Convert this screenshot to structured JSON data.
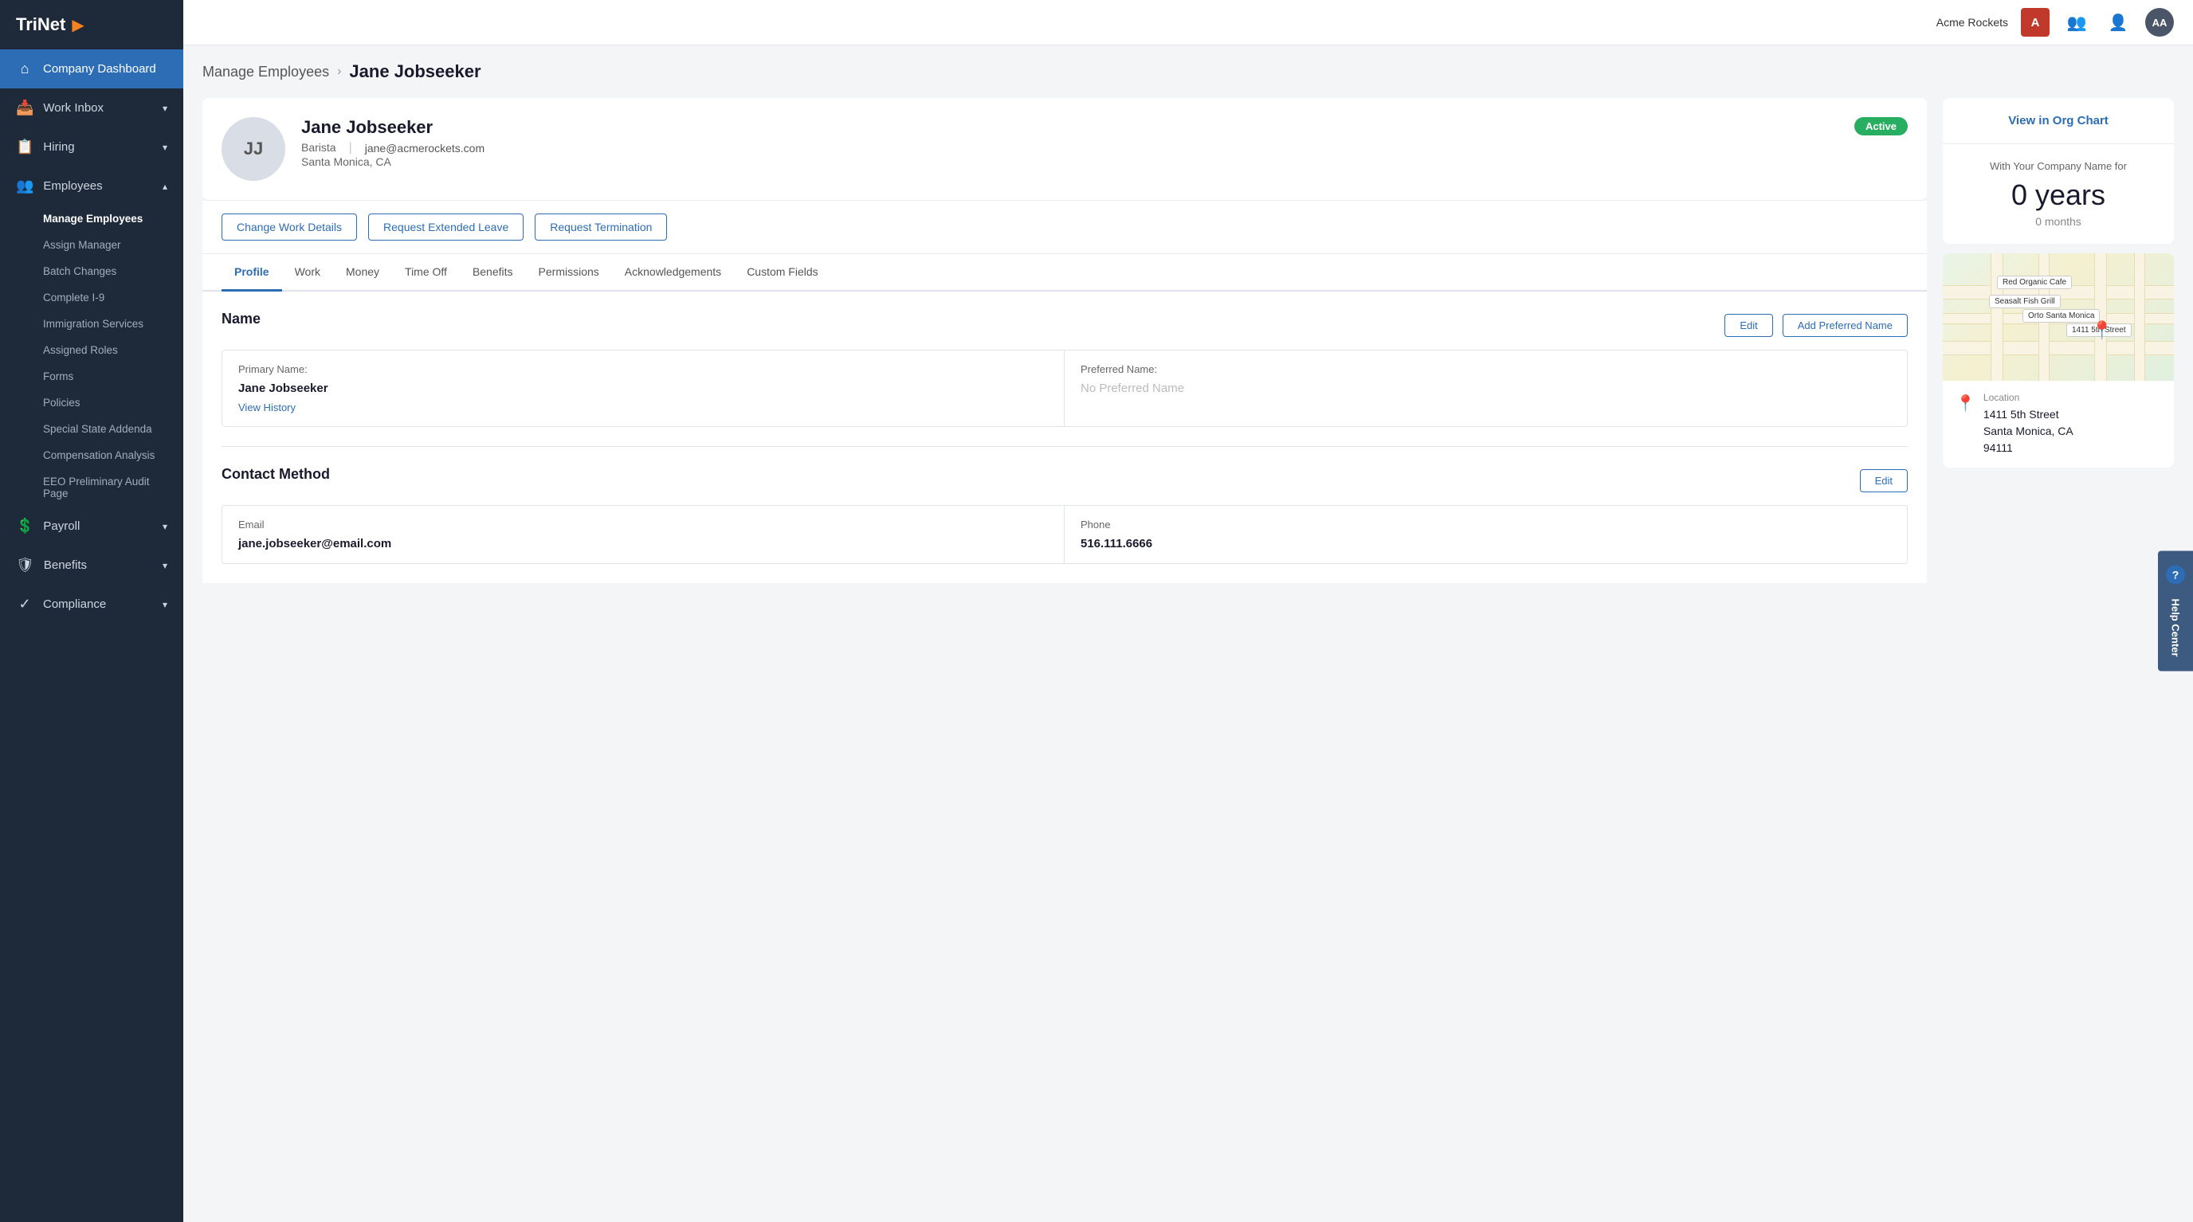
{
  "brand": {
    "name": "TriNet",
    "arrow": "▶"
  },
  "topbar": {
    "company_name": "Acme Rockets",
    "company_badge": "A",
    "user_initials": "AA"
  },
  "sidebar": {
    "items": [
      {
        "id": "company-dashboard",
        "label": "Company Dashboard",
        "icon": "⌂",
        "active": true,
        "hasChevron": false
      },
      {
        "id": "work-inbox",
        "label": "Work Inbox",
        "icon": "📥",
        "active": false,
        "hasChevron": true
      },
      {
        "id": "hiring",
        "label": "Hiring",
        "icon": "📋",
        "active": false,
        "hasChevron": true
      },
      {
        "id": "employees",
        "label": "Employees",
        "icon": "👥",
        "active": false,
        "hasChevron": true,
        "expanded": true
      },
      {
        "id": "payroll",
        "label": "Payroll",
        "icon": "💲",
        "active": false,
        "hasChevron": true
      },
      {
        "id": "benefits",
        "label": "Benefits",
        "icon": "🛡",
        "active": false,
        "hasChevron": true
      },
      {
        "id": "compliance",
        "label": "Compliance",
        "icon": "✓",
        "active": false,
        "hasChevron": true
      }
    ],
    "sub_items": [
      {
        "id": "manage-employees",
        "label": "Manage Employees",
        "active": true
      },
      {
        "id": "assign-manager",
        "label": "Assign Manager",
        "active": false
      },
      {
        "id": "batch-changes",
        "label": "Batch Changes",
        "active": false
      },
      {
        "id": "complete-i9",
        "label": "Complete I-9",
        "active": false
      },
      {
        "id": "immigration-services",
        "label": "Immigration Services",
        "active": false
      },
      {
        "id": "assigned-roles",
        "label": "Assigned Roles",
        "active": false
      },
      {
        "id": "forms",
        "label": "Forms",
        "active": false
      },
      {
        "id": "policies",
        "label": "Policies",
        "active": false
      },
      {
        "id": "special-state-addenda",
        "label": "Special State Addenda",
        "active": false
      },
      {
        "id": "compensation-analysis",
        "label": "Compensation Analysis",
        "active": false
      },
      {
        "id": "eeo-audit",
        "label": "EEO Preliminary Audit Page",
        "active": false
      }
    ]
  },
  "breadcrumb": {
    "parent": "Manage Employees",
    "current": "Jane Jobseeker"
  },
  "employee": {
    "initials": "JJ",
    "name": "Jane Jobseeker",
    "title": "Barista",
    "location": "Santa Monica, CA",
    "email": "jane@acmerockets.com",
    "status": "Active"
  },
  "action_buttons": [
    {
      "id": "change-work-details",
      "label": "Change Work Details"
    },
    {
      "id": "request-extended-leave",
      "label": "Request Extended Leave"
    },
    {
      "id": "request-termination",
      "label": "Request Termination"
    }
  ],
  "tabs": [
    {
      "id": "profile",
      "label": "Profile",
      "active": true
    },
    {
      "id": "work",
      "label": "Work",
      "active": false
    },
    {
      "id": "money",
      "label": "Money",
      "active": false
    },
    {
      "id": "time-off",
      "label": "Time Off",
      "active": false
    },
    {
      "id": "benefits",
      "label": "Benefits",
      "active": false
    },
    {
      "id": "permissions",
      "label": "Permissions",
      "active": false
    },
    {
      "id": "acknowledgements",
      "label": "Acknowledgements",
      "active": false
    },
    {
      "id": "custom-fields",
      "label": "Custom Fields",
      "active": false
    }
  ],
  "profile": {
    "name_section": {
      "title": "Name",
      "edit_label": "Edit",
      "add_preferred_label": "Add Preferred Name",
      "primary_name_label": "Primary Name:",
      "primary_name_value": "Jane Jobseeker",
      "preferred_name_label": "Preferred Name:",
      "preferred_name_value": "No Preferred Name",
      "view_history_label": "View History"
    },
    "contact_section": {
      "title": "Contact Method",
      "edit_label": "Edit",
      "email_label": "Email",
      "email_value": "jane.jobseeker@email.com",
      "phone_label": "Phone",
      "phone_value": "516.111.6666"
    }
  },
  "right_panel": {
    "org_chart_label": "View in Org Chart",
    "tenure_label": "With Your Company Name for",
    "tenure_years": "0 years",
    "tenure_months": "0 months",
    "location_label": "Location",
    "address_line1": "1411 5th Street",
    "address_line2": "Santa Monica, CA",
    "address_line3": "94111",
    "map_label": "1411 5th Street"
  },
  "help_center": {
    "question_mark": "?",
    "label": "Help Center"
  }
}
